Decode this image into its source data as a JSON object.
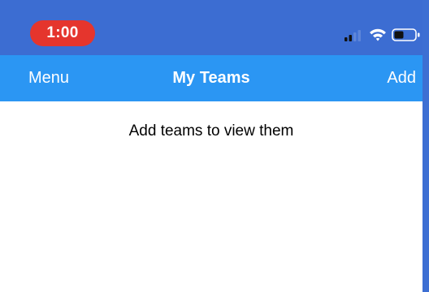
{
  "status_bar": {
    "time": "1:00",
    "time_pill_color": "#e5352d",
    "icons": [
      "cellular-signal-icon",
      "wifi-icon",
      "battery-icon"
    ]
  },
  "nav": {
    "left_label": "Menu",
    "title": "My Teams",
    "right_label": "Add",
    "background_color": "#2b96f3"
  },
  "content": {
    "empty_message": "Add teams to view them"
  },
  "colors": {
    "frame": "#3d6fd3",
    "content_background": "#ffffff"
  }
}
